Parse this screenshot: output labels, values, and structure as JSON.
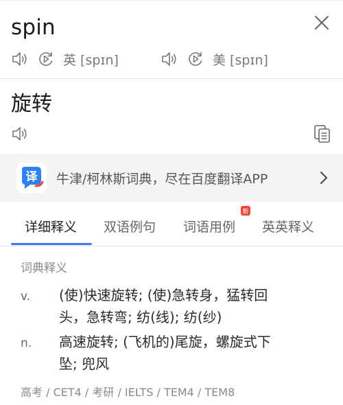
{
  "header": {
    "word": "spin",
    "uk_label": "英 [spɪn]",
    "us_label": "美 [spɪn]"
  },
  "translation": {
    "text": "旋转"
  },
  "banner": {
    "text": "牛津/柯林斯词典，尽在百度翻译APP"
  },
  "tabs": [
    {
      "label": "详细释义",
      "active": true
    },
    {
      "label": "双语例句",
      "active": false
    },
    {
      "label": "词语用例",
      "active": false,
      "badge": "新"
    },
    {
      "label": "英英释义",
      "active": false
    }
  ],
  "dictionary": {
    "section_label": "词典释义",
    "entries": [
      {
        "pos": "v.",
        "line1": "(使)快速旋转; (使)急转身，猛转回",
        "line2": "头，急转弯; 纺(线); 纺(纱)"
      },
      {
        "pos": "n.",
        "line1": "高速旋转; (飞机的)尾旋，螺旋式下",
        "line2": "坠; 兜风"
      }
    ],
    "exam_tags": "高考 / CET4 / 考研 / IELTS / TEM4 / TEM8"
  },
  "colors": {
    "accent": "#3a7cf5",
    "badge": "#f0443a"
  }
}
